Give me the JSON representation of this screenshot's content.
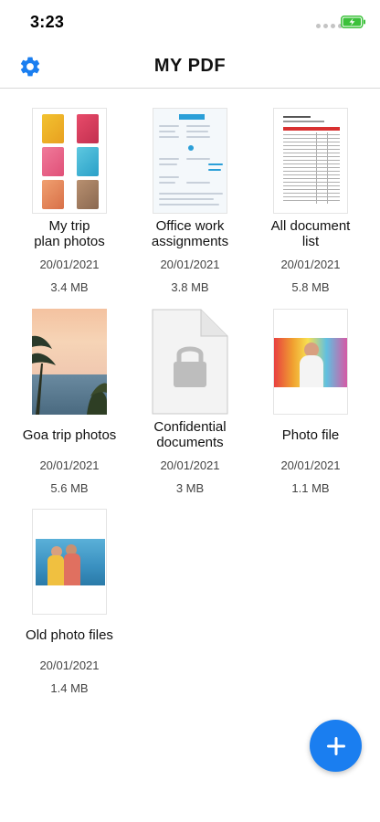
{
  "status": {
    "time": "3:23"
  },
  "header": {
    "title": "MY PDF"
  },
  "files": [
    {
      "name": "My trip plan photos",
      "name_line1": "My trip",
      "name_line2": "plan photos",
      "date": "20/01/2021",
      "size": "3.4 MB",
      "icon": "photo-collage-thumbnail"
    },
    {
      "name": "Office work assignments",
      "name_line1": "Office work",
      "name_line2": "assignments",
      "date": "20/01/2021",
      "size": "3.8 MB",
      "icon": "resume-document-thumbnail"
    },
    {
      "name": "All document list",
      "name_line1": "All document",
      "name_line2": "list",
      "date": "20/01/2021",
      "size": "5.8 MB",
      "icon": "spreadsheet-thumbnail"
    },
    {
      "name": "Goa trip photos",
      "date": "20/01/2021",
      "size": "5.6 MB",
      "icon": "beach-sunset-thumbnail"
    },
    {
      "name": "Confidential documents",
      "name_line1": "Confidential",
      "name_line2": "documents",
      "date": "20/01/2021",
      "size": "3 MB",
      "icon": "locked-document-icon"
    },
    {
      "name": "Photo file",
      "date": "20/01/2021",
      "size": "1.1 MB",
      "icon": "portrait-photo-thumbnail"
    },
    {
      "name": "Old photo files",
      "date": "20/01/2021",
      "size": "1.4 MB",
      "icon": "friends-photo-thumbnail"
    }
  ],
  "colors": {
    "accent": "#1a7ef0",
    "battery": "#3cc13b"
  },
  "icons": {
    "settings": "gear-icon",
    "add": "plus-icon"
  }
}
